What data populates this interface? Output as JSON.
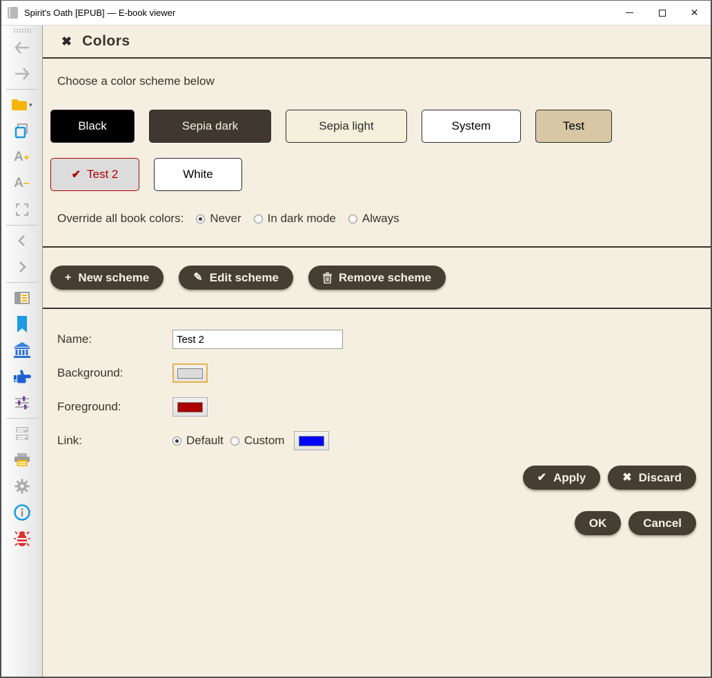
{
  "window": {
    "title": "Spirit's Oath [EPUB] — E-book viewer",
    "controls": {
      "minimize": "minimize",
      "maximize": "maximize",
      "close_glyph": "✕"
    }
  },
  "sidebar": {
    "font_increase": {
      "letter": "A",
      "mod": "+"
    },
    "font_decrease": {
      "letter": "A",
      "mod": "−"
    },
    "chevron_left": "‹",
    "chevron_right": "›",
    "folder_caret": "▾"
  },
  "panel": {
    "close_glyph": "✖",
    "title": "Colors",
    "subtitle": "Choose a color scheme below",
    "schemes": {
      "items": [
        {
          "label": "Black",
          "bg": "#000000",
          "fg": "#ffffff",
          "selected": false
        },
        {
          "label": "Sepia dark",
          "bg": "#40382e",
          "fg": "#f4efe1",
          "selected": false
        },
        {
          "label": "Sepia light",
          "bg": "#f5f0dc",
          "fg": "#2b2b2b",
          "selected": false
        },
        {
          "label": "System",
          "bg": "#ffffff",
          "fg": "#000000",
          "selected": false
        },
        {
          "label": "Test",
          "bg": "#d7c7a4",
          "fg": "#000000",
          "selected": false
        },
        {
          "label": "Test 2",
          "bg": "#dcdcdc",
          "fg": "#aa0000",
          "selected": true,
          "check_glyph": "✔"
        },
        {
          "label": "White",
          "bg": "#ffffff",
          "fg": "#000000",
          "selected": false
        }
      ]
    },
    "override": {
      "label": "Override all book colors:",
      "options": [
        {
          "label": "Never",
          "selected": true
        },
        {
          "label": "In dark mode",
          "selected": false
        },
        {
          "label": "Always",
          "selected": false
        }
      ]
    },
    "scheme_actions": {
      "new_glyph": "+",
      "new_label": "New scheme",
      "edit_glyph": "✎",
      "edit_label": "Edit scheme",
      "remove_label": "Remove scheme"
    },
    "form": {
      "name_label": "Name:",
      "name_value": "Test 2",
      "background_label": "Background:",
      "background_color": "#dcdcdc",
      "foreground_label": "Foreground:",
      "foreground_color": "#aa0000",
      "link_label": "Link:",
      "link_options": [
        {
          "label": "Default",
          "selected": true
        },
        {
          "label": "Custom",
          "selected": false
        }
      ],
      "link_color": "#0000ff"
    },
    "buttons": {
      "apply_glyph": "✔",
      "apply": "Apply",
      "discard_glyph": "✖",
      "discard": "Discard",
      "ok": "OK",
      "cancel": "Cancel"
    }
  },
  "colors": {
    "panel_bg": "#f4efe1",
    "text_dark": "#3a332b",
    "pill_bg": "#473e33",
    "selected_scheme_border": "#aa0000",
    "focus_ring": "#e8b24c"
  }
}
